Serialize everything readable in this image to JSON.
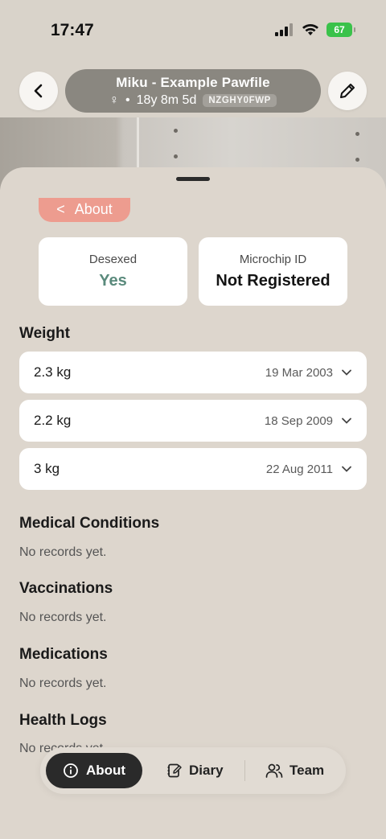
{
  "status_bar": {
    "time": "17:47",
    "battery": "67"
  },
  "header": {
    "title": "Miku - Example Pawfile",
    "sex_symbol": "♀",
    "separator": "•",
    "age": "18y 8m 5d",
    "pet_id": "NZGHY0FWP",
    "back_icon": "chevron-left-icon",
    "edit_icon": "pencil-icon"
  },
  "about_tab": {
    "chevron": "<",
    "label": "About"
  },
  "info_cards": [
    {
      "label": "Desexed",
      "value": "Yes"
    },
    {
      "label": "Microchip ID",
      "value": "Not Registered"
    }
  ],
  "weight": {
    "title": "Weight",
    "entries": [
      {
        "value": "2.3 kg",
        "date": "19 Mar 2003"
      },
      {
        "value": "2.2 kg",
        "date": "18 Sep 2009"
      },
      {
        "value": "3 kg",
        "date": "22 Aug 2011"
      }
    ]
  },
  "sections": [
    {
      "title": "Medical Conditions",
      "empty_text": "No records yet."
    },
    {
      "title": "Vaccinations",
      "empty_text": "No records yet."
    },
    {
      "title": "Medications",
      "empty_text": "No records yet."
    },
    {
      "title": "Health Logs",
      "empty_text": "No records yet."
    }
  ],
  "bottom_nav": {
    "about": "About",
    "diary": "Diary",
    "team": "Team"
  },
  "colors": {
    "accent_yes": "#5a8a7c",
    "about_chip": "#ed9c8f",
    "battery": "#3ac24a"
  }
}
